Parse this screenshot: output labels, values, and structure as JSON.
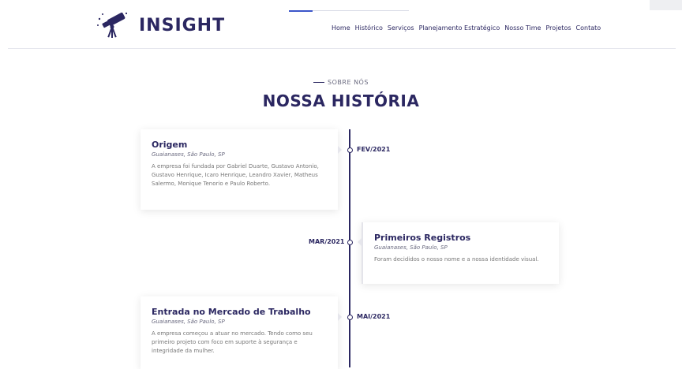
{
  "header": {
    "logo_text": "INSIGHT",
    "nav": [
      "Home",
      "Histórico",
      "Serviços",
      "Planejamento Estratégico",
      "Nosso Time",
      "Projetos",
      "Contato"
    ]
  },
  "section": {
    "eyebrow": "SOBRE NÓS",
    "title": "NOSSA HISTÓRIA"
  },
  "timeline": [
    {
      "title": "Origem",
      "location": "Guaianases, São Paulo, SP",
      "text": "A empresa foi fundada por Gabriel Duarte, Gustavo Antonio, Gustavo Henrique, Icaro Henrique, Leandro Xavier, Matheus Salermo, Monique Tenorio e Paulo Roberto.",
      "date": "FEV/2021"
    },
    {
      "title": "Primeiros Registros",
      "location": "Guaianases, São Paulo, SP",
      "text": "Foram decididos o nosso nome e a nossa identidade visual.",
      "date": "MAR/2021"
    },
    {
      "title": "Entrada no Mercado de Trabalho",
      "location": "Guaianases, São Paulo, SP",
      "text": "A empresa começou a atuar no mercado. Tendo como seu primeiro projeto com foco em suporte à segurança e integridade da mulher.",
      "date": "MAI/2021"
    }
  ],
  "colors": {
    "brand": "#2b2761",
    "accent": "#3b55c9"
  }
}
